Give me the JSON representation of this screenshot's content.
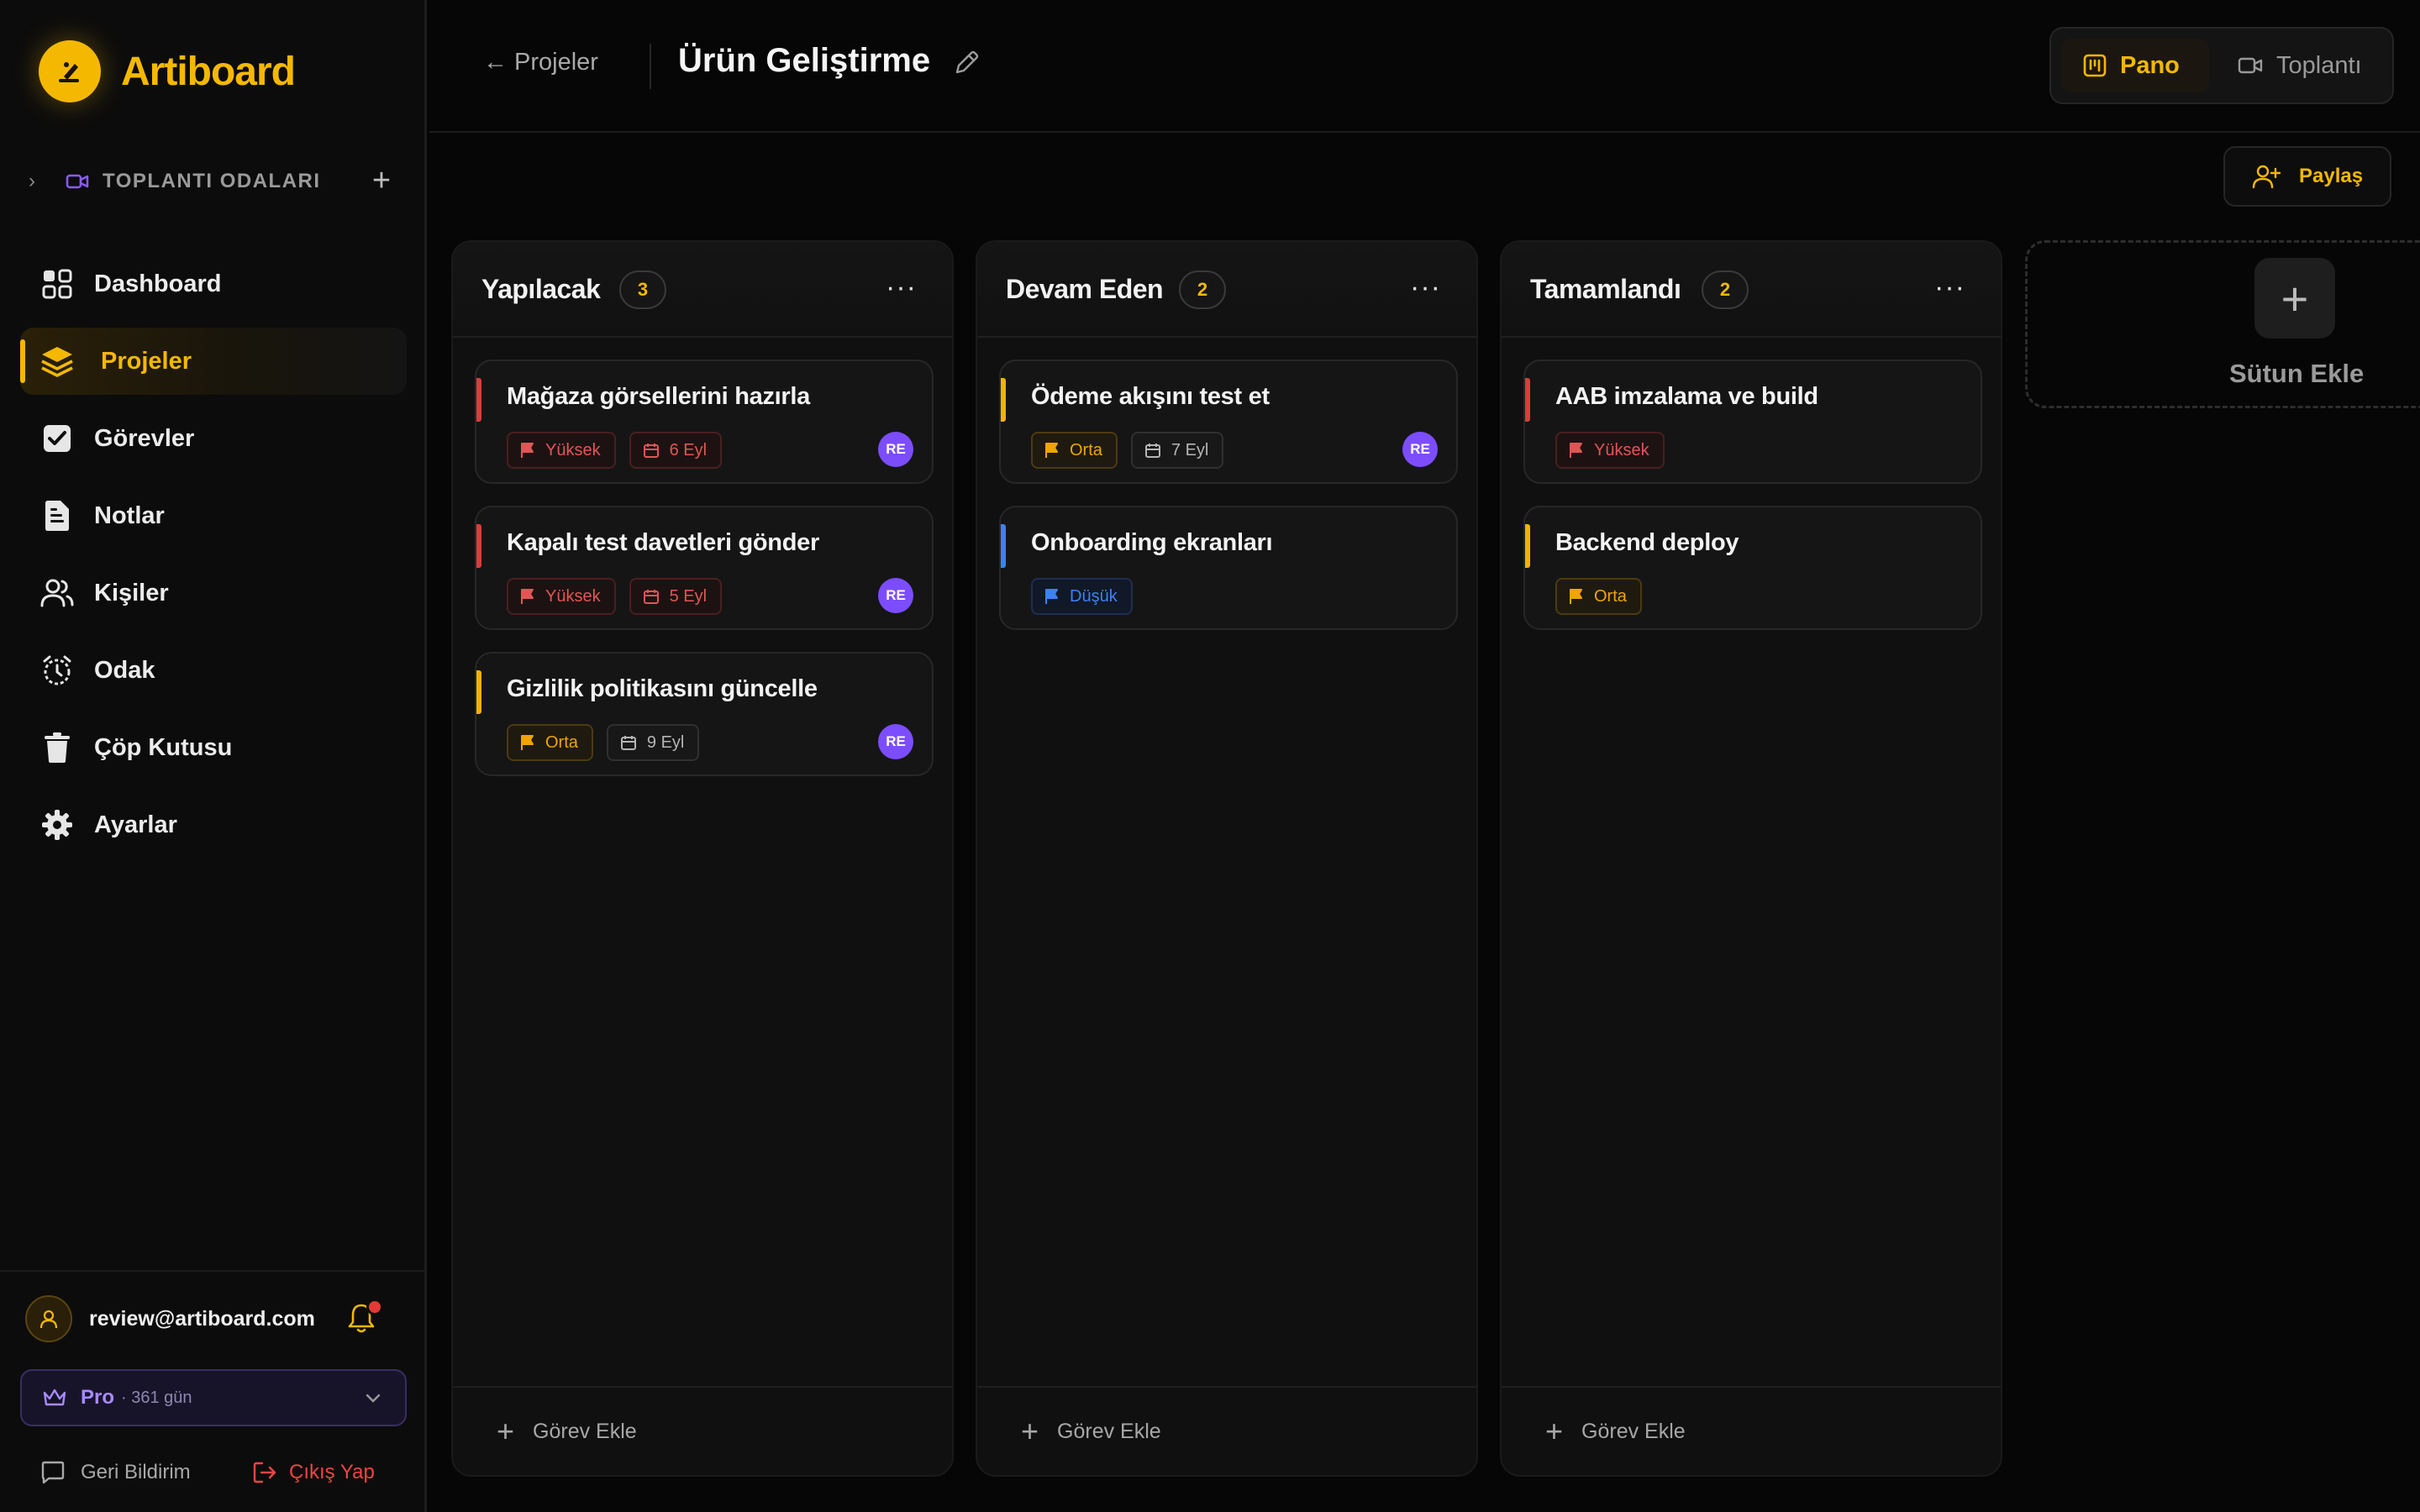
{
  "app": {
    "name": "Artiboard",
    "brand_color": "#f5b800"
  },
  "sidebar": {
    "meeting_rooms_label": "TOPLANTI ODALARI",
    "items": [
      {
        "label": "Dashboard",
        "icon": "dashboard-icon"
      },
      {
        "label": "Projeler",
        "icon": "layers-icon",
        "active": true
      },
      {
        "label": "Görevler",
        "icon": "checkbox-icon"
      },
      {
        "label": "Notlar",
        "icon": "note-icon"
      },
      {
        "label": "Kişiler",
        "icon": "users-icon"
      },
      {
        "label": "Odak",
        "icon": "alarm-clock-icon"
      },
      {
        "label": "Çöp Kutusu",
        "icon": "trash-icon"
      },
      {
        "label": "Ayarlar",
        "icon": "gear-icon"
      }
    ],
    "user_email": "review@artiboard.com",
    "plan": "Pro",
    "plan_days": "· 361 gün",
    "feedback_label": "Geri Bildirim",
    "logout_label": "Çıkış Yap"
  },
  "header": {
    "back_label": "Projeler",
    "title": "Ürün Geliştirme",
    "view_board": "Pano",
    "view_meeting": "Toplantı",
    "share_label": "Paylaş"
  },
  "board": {
    "add_task_label": "Görev Ekle",
    "add_column_label": "Sütun Ekle",
    "columns": [
      {
        "title": "Yapılacak",
        "count": "3",
        "cards": [
          {
            "title": "Mağaza görsellerini hazırla",
            "priority": "Yüksek",
            "priority_level": "high",
            "date": "6 Eyl",
            "date_overdue": true,
            "assignee": "RE"
          },
          {
            "title": "Kapalı test davetleri gönder",
            "priority": "Yüksek",
            "priority_level": "high",
            "date": "5 Eyl",
            "date_overdue": true,
            "assignee": "RE"
          },
          {
            "title": "Gizlilik politikasını güncelle",
            "priority": "Orta",
            "priority_level": "mid",
            "date": "9 Eyl",
            "date_overdue": false,
            "assignee": "RE"
          }
        ]
      },
      {
        "title": "Devam Eden",
        "count": "2",
        "cards": [
          {
            "title": "Ödeme akışını test et",
            "priority": "Orta",
            "priority_level": "mid",
            "date": "7 Eyl",
            "date_overdue": false,
            "assignee": "RE"
          },
          {
            "title": "Onboarding ekranları",
            "priority": "Düşük",
            "priority_level": "low"
          }
        ]
      },
      {
        "title": "Tamamlandı",
        "count": "2",
        "cards": [
          {
            "title": "AAB imzalama ve build",
            "priority": "Yüksek",
            "priority_level": "high"
          },
          {
            "title": "Backend deploy",
            "priority": "Orta",
            "priority_level": "mid"
          }
        ]
      }
    ]
  },
  "colors": {
    "high": "#e25555",
    "mid": "#f0b400",
    "low": "#3b82f6",
    "avatar": "#7c4dff"
  }
}
